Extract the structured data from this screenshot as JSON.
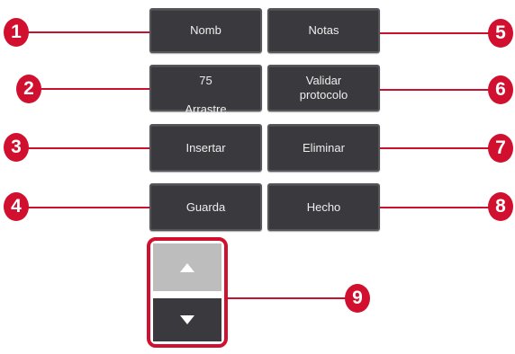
{
  "buttons": {
    "name": "Nomb",
    "notes": "Notas",
    "drag_line1": "75",
    "drag_line2": "Arrastre",
    "validate": "Validar\nprotocolo",
    "insert": "Insertar",
    "delete": "Eliminar",
    "save": "Guarda",
    "done": "Hecho"
  },
  "callouts": [
    "1",
    "2",
    "3",
    "4",
    "5",
    "6",
    "7",
    "8",
    "9"
  ],
  "icons": {
    "scroll_up": "arrow-up-icon",
    "scroll_down": "arrow-down-icon"
  },
  "colors": {
    "callout": "#d0102e",
    "button": "#3a3a3e",
    "scroll_up_bg": "#bdbdbd"
  }
}
